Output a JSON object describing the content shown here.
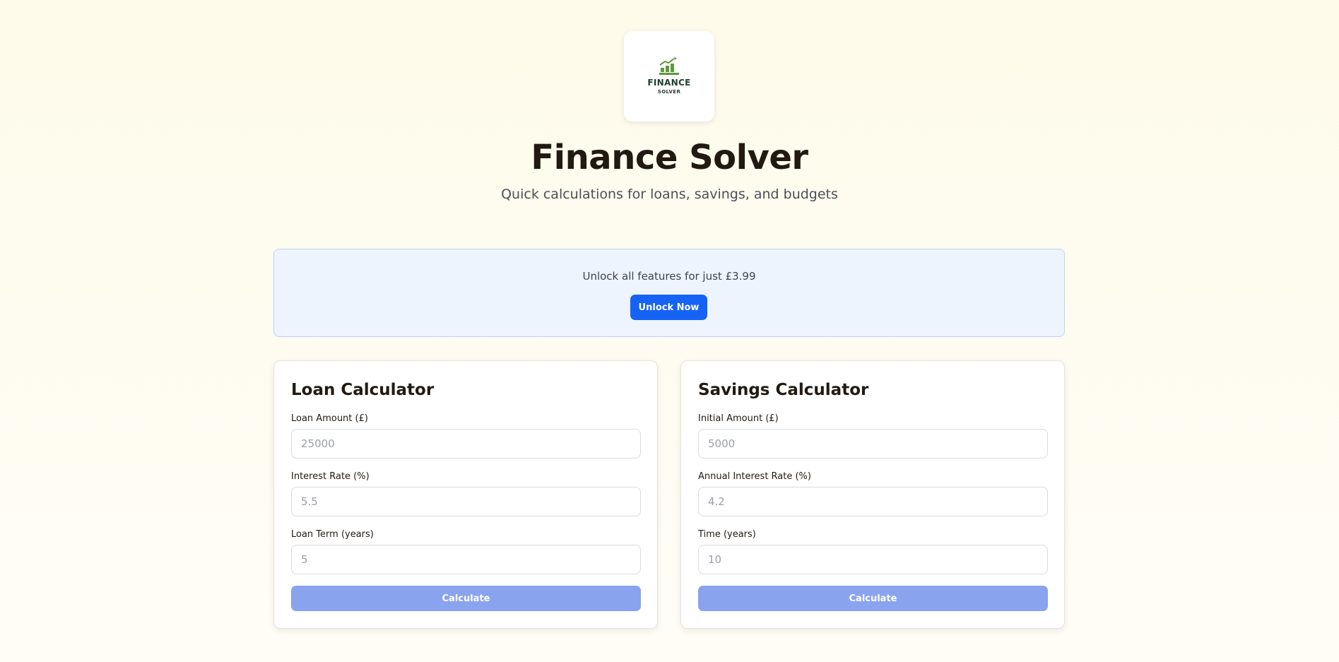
{
  "logo": {
    "word": "FINANCE",
    "sub": "SOLVER",
    "icon": "bar-chart-trend-icon",
    "colors": {
      "bars": "#5c9a3c",
      "text": "#1f3d2b"
    }
  },
  "header": {
    "title": "Finance Solver",
    "subtitle": "Quick calculations for loans, savings, and budgets"
  },
  "promo": {
    "text": "Unlock all features for just £3.99",
    "button_label": "Unlock Now",
    "colors": {
      "background": "#edf4fe",
      "button": "#1563f5"
    }
  },
  "loan_calculator": {
    "title": "Loan Calculator",
    "fields": [
      {
        "label": "Loan Amount (£)",
        "placeholder": "25000",
        "value": ""
      },
      {
        "label": "Interest Rate (%)",
        "placeholder": "5.5",
        "value": ""
      },
      {
        "label": "Loan Term (years)",
        "placeholder": "5",
        "value": ""
      }
    ],
    "button_label": "Calculate"
  },
  "savings_calculator": {
    "title": "Savings Calculator",
    "fields": [
      {
        "label": "Initial Amount (£)",
        "placeholder": "5000",
        "value": ""
      },
      {
        "label": "Annual Interest Rate (%)",
        "placeholder": "4.2",
        "value": ""
      },
      {
        "label": "Time (years)",
        "placeholder": "10",
        "value": ""
      }
    ],
    "button_label": "Calculate"
  },
  "colors": {
    "calculate_button": "#8aa3ef",
    "page_background": "#fefbea"
  }
}
